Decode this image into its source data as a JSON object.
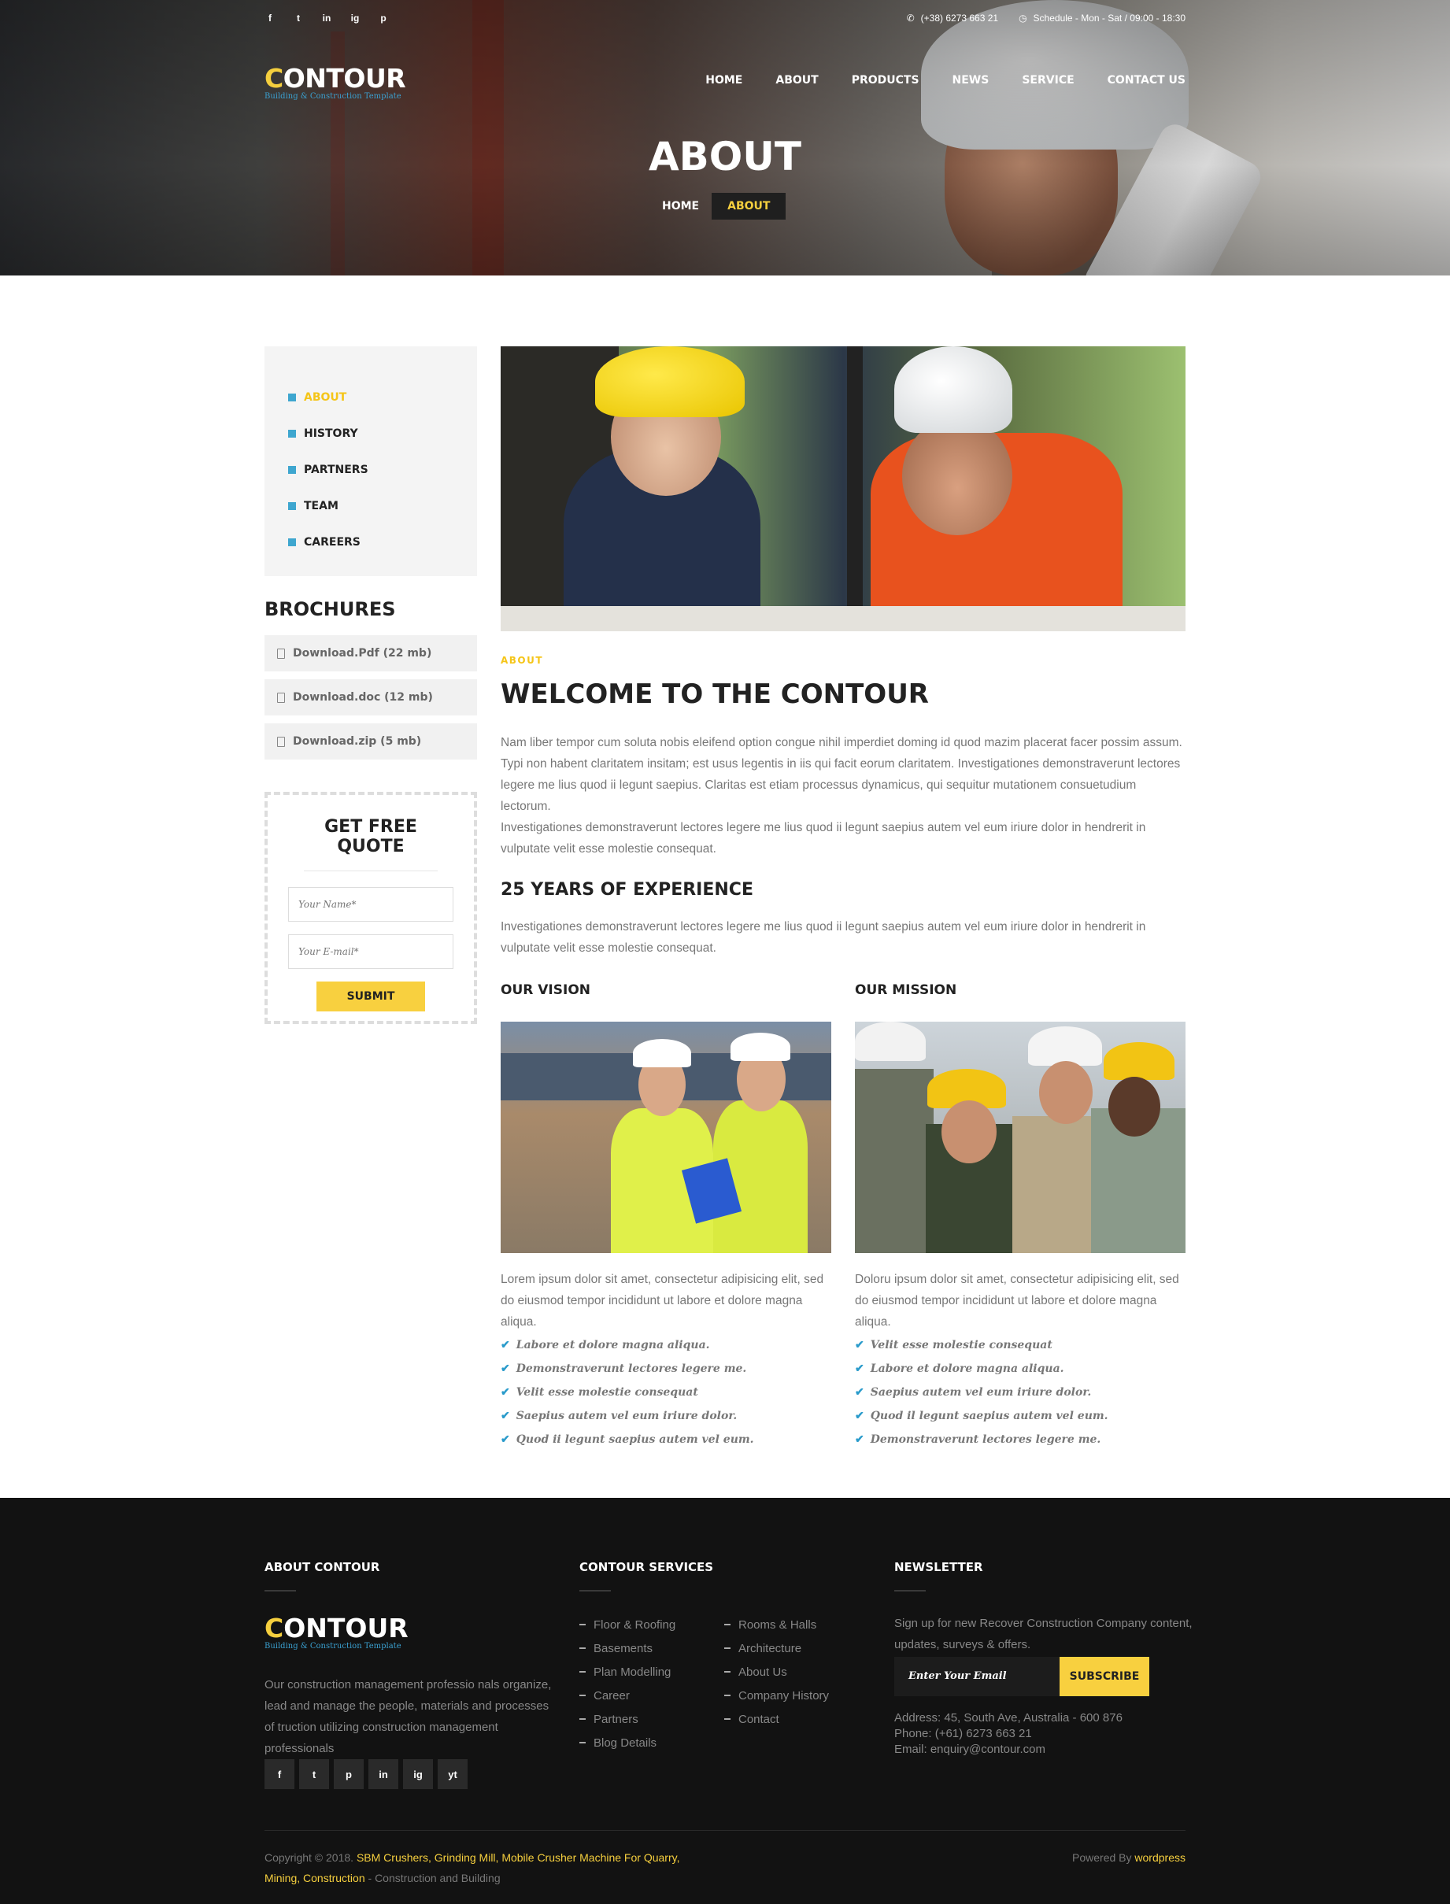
{
  "topbar": {
    "social": [
      "f",
      "t",
      "in",
      "ig",
      "p"
    ],
    "phone": "(+38) 6273 663 21",
    "schedule": "Schedule - Mon - Sat / 09:00 - 18:30"
  },
  "logo": {
    "first_letter": "C",
    "rest": "ONTOUR",
    "tagline": "Building & Construction Template"
  },
  "nav": [
    "HOME",
    "ABOUT",
    "PRODUCTS",
    "NEWS",
    "SERVICE",
    "CONTACT US"
  ],
  "page_title": "ABOUT",
  "breadcrumb": {
    "home": "HOME",
    "current": "ABOUT"
  },
  "sidebar": {
    "menu": [
      {
        "label": "ABOUT",
        "active": true
      },
      {
        "label": "HISTORY",
        "active": false
      },
      {
        "label": "PARTNERS",
        "active": false
      },
      {
        "label": "TEAM",
        "active": false
      },
      {
        "label": "CAREERS",
        "active": false
      }
    ],
    "brochures_title": "BROCHURES",
    "brochures": [
      "Download.Pdf (22 mb)",
      "Download.doc (12 mb)",
      "Download.zip (5 mb)"
    ],
    "quote": {
      "title": "GET FREE QUOTE",
      "name_placeholder": "Your Name*",
      "email_placeholder": "Your E-mail*",
      "submit": "SUBMIT"
    }
  },
  "main": {
    "label": "ABOUT",
    "heading": "WELCOME TO THE CONTOUR",
    "para1": "Nam liber tempor cum soluta nobis eleifend option congue nihil imperdiet doming id quod mazim placerat facer possim assum. Typi non habent claritatem insitam; est usus legentis in iis qui facit eorum claritatem. Investigationes demonstraverunt lectores legere me lius quod ii legunt saepius. Claritas est etiam processus dynamicus, qui sequitur mutationem consuetudium lectorum.",
    "para2": "Investigationes demonstraverunt lectores legere me lius quod ii legunt saepius autem vel eum iriure dolor in hendrerit in vulputate velit esse molestie consequat.",
    "experience_title": "25 YEARS OF EXPERIENCE",
    "experience_text": "Investigationes demonstraverunt lectores legere me lius quod ii legunt saepius autem vel eum iriure dolor in hendrerit in vulputate velit esse molestie consequat.",
    "vision": {
      "title": "OUR VISION",
      "text": "Lorem ipsum dolor sit amet, consectetur adipisicing elit, sed do eiusmod tempor incididunt ut labore et dolore magna aliqua.",
      "items": [
        "Labore et dolore magna aliqua.",
        "Demonstraverunt lectores legere me.",
        "Velit esse molestie consequat",
        "Saepius autem vel eum iriure dolor.",
        "Quod ii legunt saepius autem vel eum."
      ]
    },
    "mission": {
      "title": "OUR MISSION",
      "text": "Doloru ipsum dolor sit amet, consectetur adipisicing elit, sed do eiusmod tempor incididunt ut labore et dolore magna aliqua.",
      "items": [
        "Velit esse molestie consequat",
        "Labore et dolore magna aliqua.",
        "Saepius autem vel eum iriure dolor.",
        "Quod il legunt saepius autem vel eum.",
        "Demonstraverunt lectores legere me."
      ]
    }
  },
  "footer": {
    "about_title": "ABOUT CONTOUR",
    "about_text": "Our construction management professio nals organize, lead and manage the people, materials and processes of truction utilizing construction management professionals",
    "social": [
      "f",
      "t",
      "p",
      "in",
      "ig",
      "yt"
    ],
    "services_title": "CONTOUR SERVICES",
    "services_col1": [
      "Floor & Roofing",
      "Basements",
      "Plan Modelling",
      "Career",
      "Partners",
      "Blog Details"
    ],
    "services_col2": [
      "Rooms & Halls",
      "Architecture",
      "About Us",
      "Company History",
      "Contact"
    ],
    "newsletter_title": "NEWSLETTER",
    "newsletter_text": "Sign up for new Recover Construction Company content, updates, surveys & offers.",
    "newsletter_placeholder": "Enter Your Email",
    "subscribe": "SUBSCRIBE",
    "address": "Address:  45, South Ave, Australia - 600 876",
    "phone": "Phone:  (+61) 6273 663 21",
    "email": "Email:  enquiry@contour.com",
    "copyright_prefix": "Copyright © 2018.",
    "copyright_link": "SBM Crushers, Grinding Mill, Mobile Crusher Machine For Quarry, Mining, Construction",
    "copyright_suffix": "- Construction and Building",
    "powered_prefix": "Powered By",
    "powered_link": "wordpress"
  },
  "colors": {
    "accent": "#f5c518",
    "button": "#f8d03f",
    "blue": "#3ea6cf",
    "footer_bg": "#121212"
  }
}
